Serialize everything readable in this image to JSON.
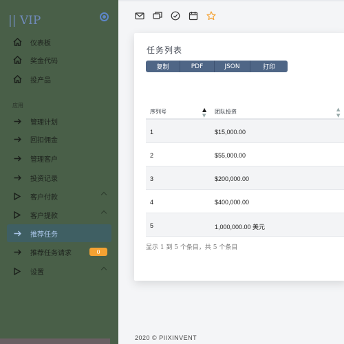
{
  "sidebar": {
    "brand": "|| VIP",
    "items": [
      {
        "label": "仪表板",
        "icon": "home-icon"
      },
      {
        "label": "奖金代码",
        "icon": "home-icon"
      },
      {
        "label": "投产品",
        "icon": "home-icon"
      }
    ],
    "section_label": "应用",
    "app_items": [
      {
        "label": "管理计划",
        "icon": "arrow-right-icon"
      },
      {
        "label": "回扣佣金",
        "icon": "arrow-right-icon"
      },
      {
        "label": "管理客户",
        "icon": "arrow-right-icon"
      },
      {
        "label": "投资记录",
        "icon": "arrow-right-icon"
      },
      {
        "label": "客户付款",
        "icon": "play-icon"
      },
      {
        "label": "客户提款",
        "icon": "play-icon"
      },
      {
        "label": "推荐任务",
        "icon": "arrow-right-icon"
      },
      {
        "label": "推荐任务请求",
        "icon": "arrow-right-icon",
        "badge": "0"
      },
      {
        "label": "设置",
        "icon": "play-icon"
      }
    ]
  },
  "topbar": {
    "icons": [
      "mail-icon",
      "chat-icon",
      "check-circle-icon",
      "calendar-icon",
      "star-icon"
    ]
  },
  "card": {
    "title": "任务列表",
    "buttons": [
      "复制",
      "PDF",
      "JSON",
      "打印"
    ],
    "columns": [
      "序列号",
      "团队投资"
    ],
    "rows": [
      {
        "serial": "1",
        "investment": "$15,000.00"
      },
      {
        "serial": "2",
        "investment": "$55,000.00"
      },
      {
        "serial": "3",
        "investment": "$200,000.00"
      },
      {
        "serial": "4",
        "investment": "$400,000.00"
      },
      {
        "serial": "5",
        "investment": "1,000,000.00 美元"
      }
    ],
    "info": "显示 1 到 5 个条目，共 5 个条目"
  },
  "footer": "2020 © PIIXINVENT",
  "colors": {
    "sidebar_bg": "#495f48",
    "active_item_bg": "#3f5f63",
    "button_bg": "#4f6686",
    "badge_bg": "#f4a233",
    "star": "#f4a233"
  }
}
